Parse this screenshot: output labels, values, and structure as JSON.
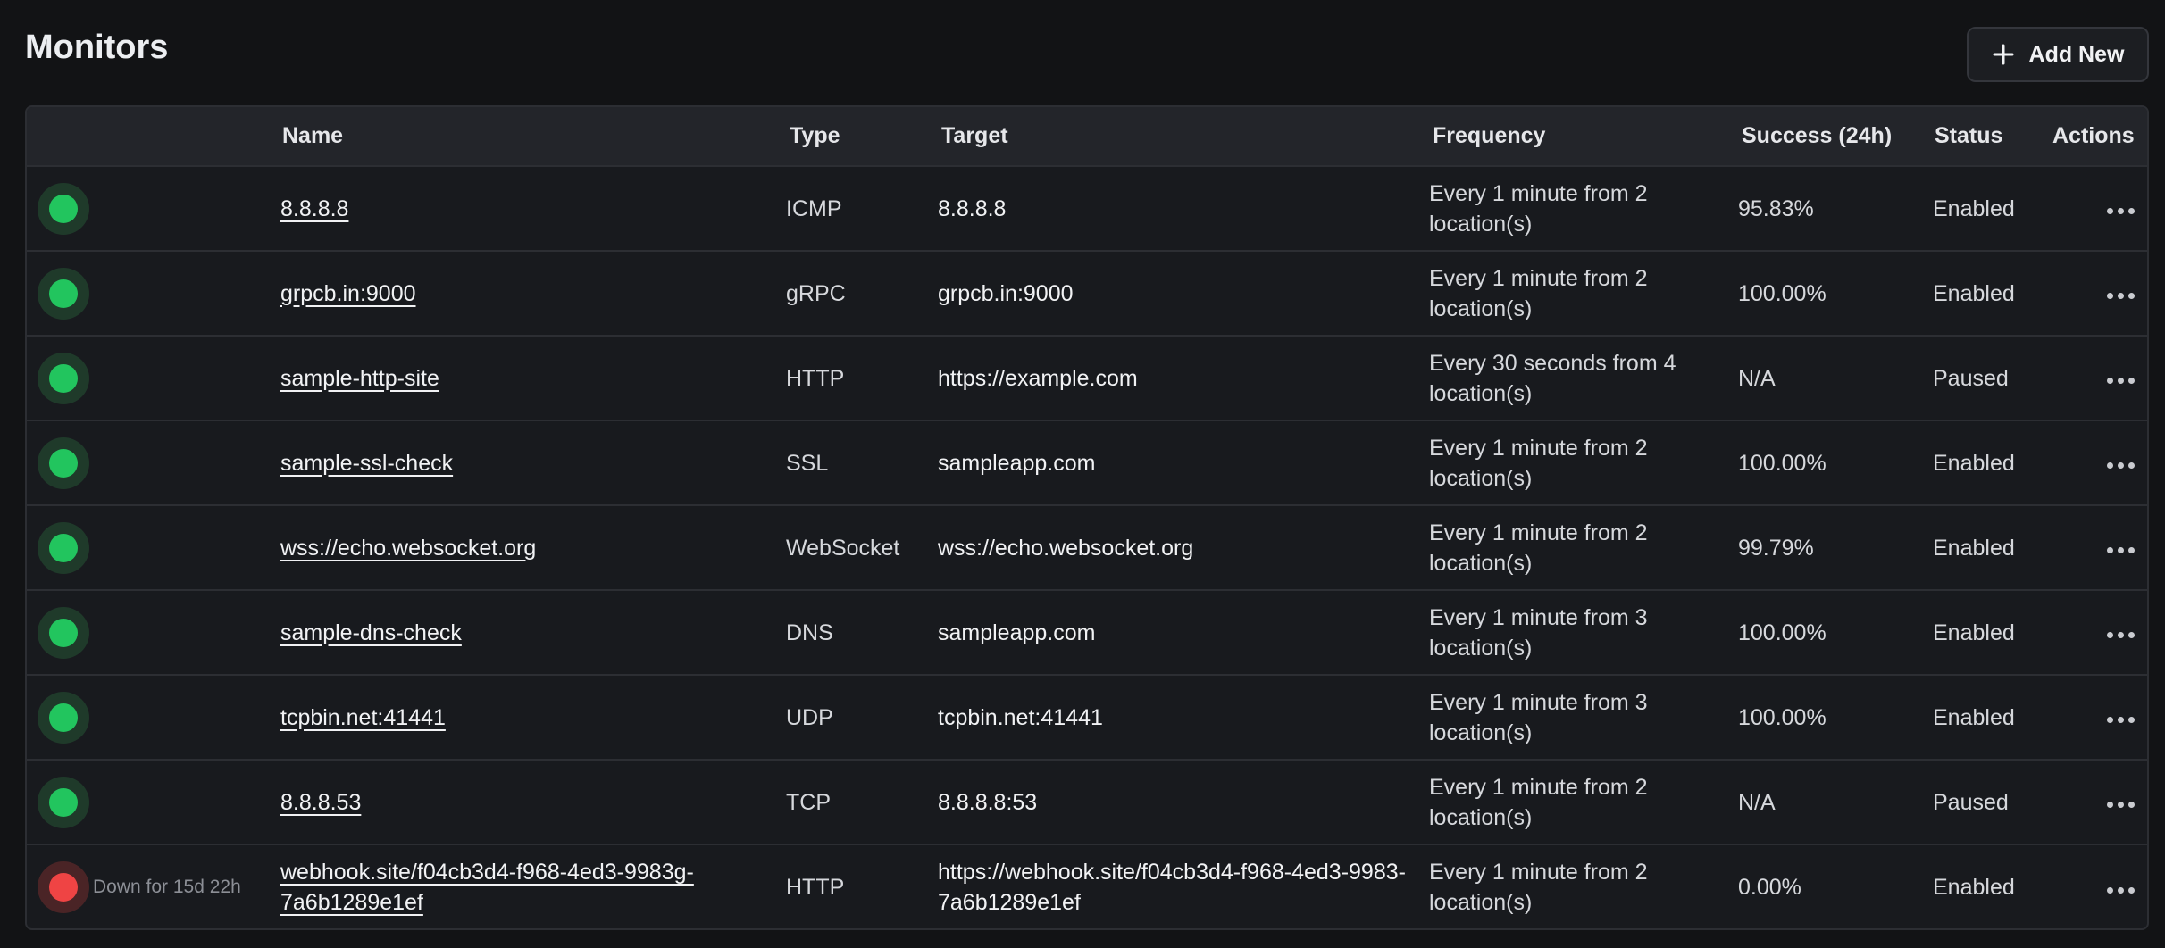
{
  "page": {
    "title": "Monitors",
    "add_button_label": "Add New"
  },
  "table": {
    "headers": {
      "name": "Name",
      "type": "Type",
      "target": "Target",
      "frequency": "Frequency",
      "success": "Success (24h)",
      "status": "Status",
      "actions": "Actions"
    },
    "rows": [
      {
        "health": "up",
        "down_text": "",
        "name": "8.8.8.8",
        "type": "ICMP",
        "target": "8.8.8.8",
        "frequency": "Every 1 minute from 2 location(s)",
        "success": "95.83%",
        "status": "Enabled"
      },
      {
        "health": "up",
        "down_text": "",
        "name": "grpcb.in:9000",
        "type": "gRPC",
        "target": "grpcb.in:9000",
        "frequency": "Every 1 minute from 2 location(s)",
        "success": "100.00%",
        "status": "Enabled"
      },
      {
        "health": "up",
        "down_text": "",
        "name": "sample-http-site",
        "type": "HTTP",
        "target": "https://example.com",
        "frequency": "Every 30 seconds from 4 location(s)",
        "success": "N/A",
        "status": "Paused"
      },
      {
        "health": "up",
        "down_text": "",
        "name": "sample-ssl-check",
        "type": "SSL",
        "target": "sampleapp.com",
        "frequency": "Every 1 minute from 2 location(s)",
        "success": "100.00%",
        "status": "Enabled"
      },
      {
        "health": "up",
        "down_text": "",
        "name": "wss://echo.websocket.org",
        "type": "WebSocket",
        "target": "wss://echo.websocket.org",
        "frequency": "Every 1 minute from 2 location(s)",
        "success": "99.79%",
        "status": "Enabled"
      },
      {
        "health": "up",
        "down_text": "",
        "name": "sample-dns-check",
        "type": "DNS",
        "target": "sampleapp.com",
        "frequency": "Every 1 minute from 3 location(s)",
        "success": "100.00%",
        "status": "Enabled"
      },
      {
        "health": "up",
        "down_text": "",
        "name": "tcpbin.net:41441",
        "type": "UDP",
        "target": "tcpbin.net:41441",
        "frequency": "Every 1 minute from 3 location(s)",
        "success": "100.00%",
        "status": "Enabled"
      },
      {
        "health": "up",
        "down_text": "",
        "name": "8.8.8.53",
        "type": "TCP",
        "target": "8.8.8.8:53",
        "frequency": "Every 1 minute from 2 location(s)",
        "success": "N/A",
        "status": "Paused"
      },
      {
        "health": "down",
        "down_text": "Down for 15d 22h",
        "name": "webhook.site/f04cb3d4-f968-4ed3-9983g-7a6b1289e1ef",
        "type": "HTTP",
        "target": "https://webhook.site/f04cb3d4-f968-4ed3-9983-7a6b1289e1ef",
        "frequency": "Every 1 minute from 2 location(s)",
        "success": "0.00%",
        "status": "Enabled"
      }
    ]
  },
  "icons": {
    "add": "plus-icon",
    "row_actions": "more-horizontal-icon",
    "health_up": "status-dot-up-icon",
    "health_down": "status-dot-down-icon"
  },
  "colors": {
    "up": "#22c55e",
    "down": "#ef4444",
    "background": "#121315"
  }
}
